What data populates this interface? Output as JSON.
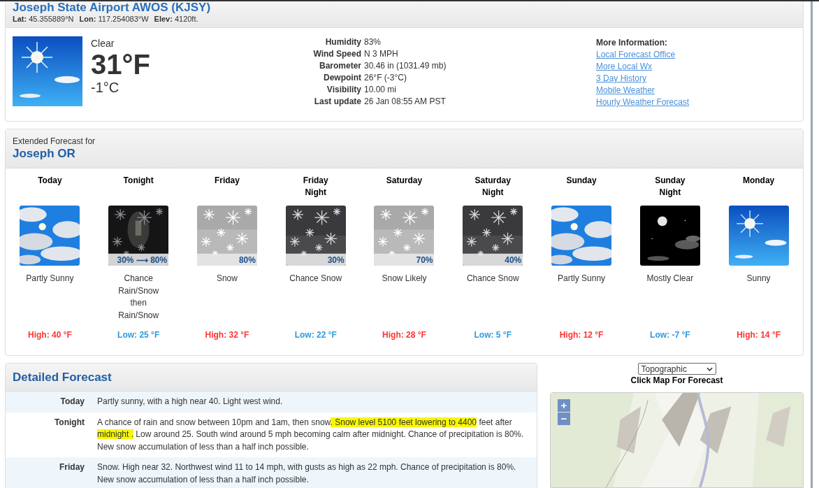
{
  "station": {
    "title": "Joseph State Airport AWOS (KJSY)",
    "coords": [
      {
        "label": "Lat:",
        "value": "45.355889°N"
      },
      {
        "label": "Lon:",
        "value": "117.254083°W"
      },
      {
        "label": "Elev:",
        "value": "4120ft."
      }
    ]
  },
  "current": {
    "condition": "Clear",
    "temp_f": "31°F",
    "temp_c": "-1°C",
    "details": [
      {
        "label": "Humidity",
        "value": "83%"
      },
      {
        "label": "Wind Speed",
        "value": "N 3 MPH"
      },
      {
        "label": "Barometer",
        "value": "30.46 in (1031.49 mb)"
      },
      {
        "label": "Dewpoint",
        "value": "26°F (-3°C)"
      },
      {
        "label": "Visibility",
        "value": "10.00 mi"
      },
      {
        "label": "Last update",
        "value": "26 Jan 08:55 AM PST"
      }
    ],
    "more_info": {
      "heading": "More Information:",
      "links": [
        "Local Forecast Office",
        "More Local Wx",
        "3 Day History",
        "Mobile Weather",
        "Hourly Weather Forecast"
      ]
    }
  },
  "extended": {
    "heading": "Extended Forecast for",
    "location": "Joseph OR",
    "periods": [
      {
        "name": [
          "Today"
        ],
        "desc": [
          "Partly Sunny"
        ],
        "temp": "High: 40 °F",
        "kind": "high"
      },
      {
        "name": [
          "Tonight"
        ],
        "pop": "30% ⟶ 80%",
        "desc": [
          "Chance",
          "Rain/Snow",
          "then",
          "Rain/Snow"
        ],
        "temp": "Low: 25 °F",
        "kind": "low"
      },
      {
        "name": [
          "Friday"
        ],
        "pop": "80%",
        "desc": [
          "Snow"
        ],
        "temp": "High: 32 °F",
        "kind": "high"
      },
      {
        "name": [
          "Friday",
          "Night"
        ],
        "pop": "30%",
        "desc": [
          "Chance Snow"
        ],
        "temp": "Low: 22 °F",
        "kind": "low"
      },
      {
        "name": [
          "Saturday"
        ],
        "pop": "70%",
        "desc": [
          "Snow Likely"
        ],
        "temp": "High: 28 °F",
        "kind": "high"
      },
      {
        "name": [
          "Saturday",
          "Night"
        ],
        "pop": "40%",
        "desc": [
          "Chance Snow"
        ],
        "temp": "Low: 5 °F",
        "kind": "low"
      },
      {
        "name": [
          "Sunday"
        ],
        "desc": [
          "Partly Sunny"
        ],
        "temp": "High: 12 °F",
        "kind": "high"
      },
      {
        "name": [
          "Sunday",
          "Night"
        ],
        "desc": [
          "Mostly Clear"
        ],
        "temp": "Low: -7 °F",
        "kind": "low"
      },
      {
        "name": [
          "Monday"
        ],
        "desc": [
          "Sunny"
        ],
        "temp": "High: 14 °F",
        "kind": "high"
      }
    ]
  },
  "detailed": {
    "heading": "Detailed Forecast",
    "rows": [
      {
        "label": "Today",
        "text": [
          {
            "text": "Partly sunny, with a high near 40. Light west wind.",
            "highlighted": false
          }
        ]
      },
      {
        "label": "Tonight",
        "text": [
          {
            "text": "A chance of rain and snow between 10pm and 1am, then snow",
            "highlighted": false
          },
          {
            "text": ". Snow level 5100 feet lowering to 4400",
            "highlighted": true
          },
          {
            "text": " feet after ",
            "highlighted": false
          },
          {
            "text": "midnight .",
            "highlighted": true
          },
          {
            "text": " Low around 25. South wind around 5 mph becoming calm after midnight. Chance of precipitation is 80%. New snow accumulation of less than a half inch possible.",
            "highlighted": false
          }
        ]
      },
      {
        "label": "Friday",
        "text": [
          {
            "text": "Snow. High near 32. Northwest wind 11 to 14 mph, with gusts as high as 22 mph. Chance of precipitation is 80%. New snow accumulation of less than a half inch possible.",
            "highlighted": false
          }
        ]
      }
    ]
  },
  "map": {
    "layer_select": "Topographic",
    "caption": "Click Map For Forecast",
    "zoom_in": "+",
    "zoom_out": "−"
  }
}
